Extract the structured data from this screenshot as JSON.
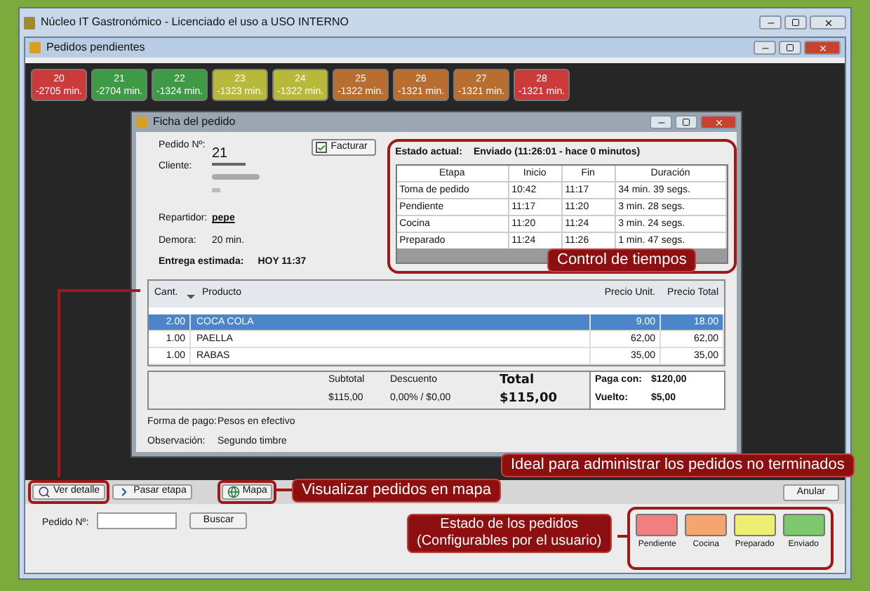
{
  "window": {
    "title": "Núcleo IT Gastronómico - Licenciado el uso a USO INTERNO"
  },
  "inner_window": {
    "title": "Pedidos pendientes"
  },
  "orders": [
    {
      "number": "20",
      "minutes": "-2705 min.",
      "color": "#cc3b3b"
    },
    {
      "number": "21",
      "minutes": "-2704 min.",
      "color": "#3f9a45"
    },
    {
      "number": "22",
      "minutes": "-1324 min.",
      "color": "#3f9a45"
    },
    {
      "number": "23",
      "minutes": "-1323 min.",
      "color": "#b8b83a"
    },
    {
      "number": "24",
      "minutes": "-1322 min.",
      "color": "#b8b83a"
    },
    {
      "number": "25",
      "minutes": "-1322 min.",
      "color": "#b86e30"
    },
    {
      "number": "26",
      "minutes": "-1321 min.",
      "color": "#b86e30"
    },
    {
      "number": "27",
      "minutes": "-1321 min.",
      "color": "#b86e30"
    },
    {
      "number": "28",
      "minutes": "-1321 min.",
      "color": "#cc3b3b"
    }
  ],
  "dialog": {
    "title": "Ficha del pedido",
    "pedido": {
      "label": "Pedido Nº:",
      "value": "21"
    },
    "cliente": {
      "label": "Cliente:"
    },
    "repartidor": {
      "label": "Repartidor:",
      "value": "pepe"
    },
    "demora": {
      "label": "Demora:",
      "value": "20 min."
    },
    "entrega": {
      "label": "Entrega estimada:",
      "value": "HOY 11:37"
    },
    "facturar": {
      "label": "Facturar",
      "checked": true
    },
    "estado": {
      "label": "Estado actual:",
      "value": "Enviado (11:26:01 - hace 0 minutos)"
    },
    "stages": {
      "columns": [
        "Etapa",
        "Inicio",
        "Fin",
        "Duración"
      ],
      "rows": [
        [
          "Toma de pedido",
          "10:42",
          "11:17",
          "34 min. 39 segs."
        ],
        [
          "Pendiente",
          "11:17",
          "11:20",
          "3 min. 28 segs."
        ],
        [
          "Cocina",
          "11:20",
          "11:24",
          "3 min. 24 segs."
        ],
        [
          "Preparado",
          "11:24",
          "11:26",
          "1 min. 47 segs."
        ]
      ]
    },
    "products": {
      "columns": [
        "Cant.",
        "Producto",
        "Precio Unit.",
        "Precio Total"
      ],
      "rows": [
        {
          "cells": [
            "2.00",
            "COCA COLA",
            "9.00",
            "18.00"
          ],
          "selected": true
        },
        {
          "cells": [
            "1.00",
            "PAELLA",
            "62,00",
            "62,00"
          ],
          "selected": false
        },
        {
          "cells": [
            "1.00",
            "RABAS",
            "35,00",
            "35,00"
          ],
          "selected": false
        }
      ]
    },
    "totals": {
      "subtotal_label": "Subtotal",
      "subtotal": "$115,00",
      "descuento_label": "Descuento",
      "descuento": "0,00% / $0,00",
      "total_label": "Total",
      "total": "$115,00",
      "paga_con_label": "Paga con:",
      "paga_con": "$120,00",
      "vuelto_label": "Vuelto:",
      "vuelto": "$5,00"
    },
    "forma_de_pago": {
      "label": "Forma de pago:",
      "value": "Pesos en efectivo"
    },
    "observacion": {
      "label": "Observación:",
      "value": "Segundo timbre"
    }
  },
  "toolbar": {
    "buttons": [
      {
        "label": "Ver detalle"
      },
      {
        "label": "Pasar etapa"
      },
      {
        "label": "Mapa"
      }
    ],
    "anular": "Anular"
  },
  "search": {
    "label": "Pedido Nº:",
    "button": "Buscar"
  },
  "legend": [
    {
      "label": "Pendiente",
      "color": "#f07f7f"
    },
    {
      "label": "Cocina",
      "color": "#f4a66e"
    },
    {
      "label": "Preparado",
      "color": "#eeee72"
    },
    {
      "label": "Enviado",
      "color": "#7ec86e"
    }
  ],
  "callouts": {
    "tiempos": "Control de tiempos",
    "ideal": "Ideal para administrar los pedidos no terminados",
    "mapa": "Visualizar pedidos en mapa",
    "estado": [
      "Estado de los pedidos",
      "(Configurables por el usuario)"
    ]
  }
}
